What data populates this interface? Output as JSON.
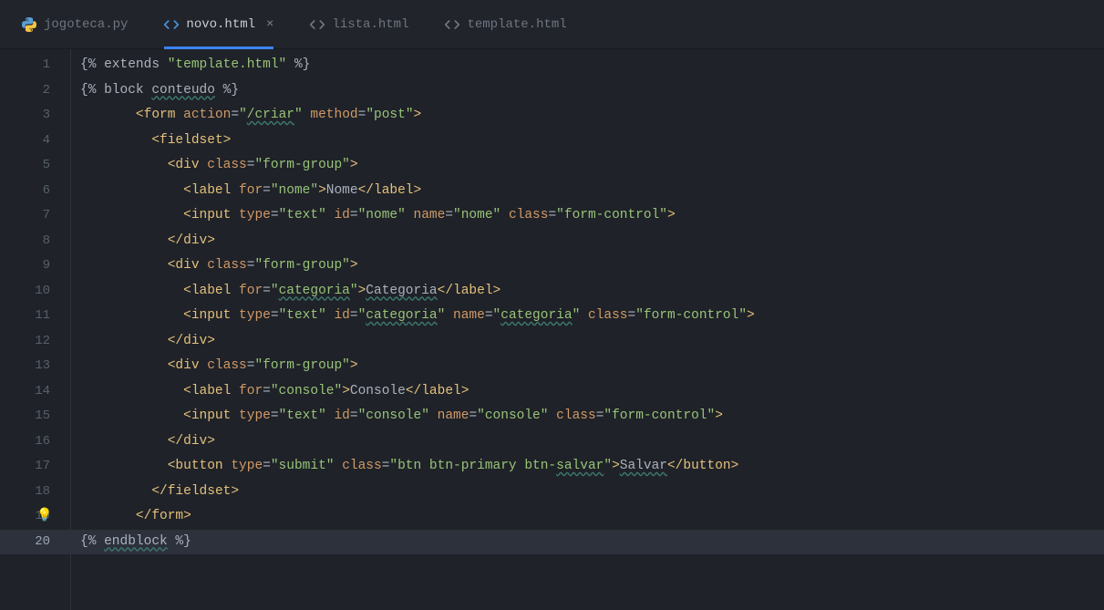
{
  "tabs": [
    {
      "label": "jogoteca.py",
      "type": "python",
      "active": false,
      "close": false
    },
    {
      "label": "novo.html",
      "type": "html",
      "active": true,
      "close": true
    },
    {
      "label": "lista.html",
      "type": "html",
      "active": false,
      "close": false
    },
    {
      "label": "template.html",
      "type": "html",
      "active": false,
      "close": false
    }
  ],
  "lines": {
    "1": {
      "n": "1"
    },
    "2": {
      "n": "2"
    },
    "3": {
      "n": "3"
    },
    "4": {
      "n": "4"
    },
    "5": {
      "n": "5"
    },
    "6": {
      "n": "6"
    },
    "7": {
      "n": "7"
    },
    "8": {
      "n": "8"
    },
    "9": {
      "n": "9"
    },
    "10": {
      "n": "10"
    },
    "11": {
      "n": "11"
    },
    "12": {
      "n": "12"
    },
    "13": {
      "n": "13"
    },
    "14": {
      "n": "14"
    },
    "15": {
      "n": "15"
    },
    "16": {
      "n": "16"
    },
    "17": {
      "n": "17"
    },
    "18": {
      "n": "18"
    },
    "19": {
      "n": "19"
    },
    "20": {
      "n": "20"
    }
  },
  "code": {
    "l1": {
      "extends": "{% extends ",
      "tpl": "\"template.html\"",
      "end": " %}"
    },
    "l2": {
      "block": "{% block ",
      "name": "conteudo",
      "end": " %}"
    },
    "l3": {
      "open": "<",
      "tag": "form",
      "sp": " ",
      "a1": "action",
      "eq": "=",
      "v1": "\"",
      "v1w": "/criar",
      "v1e": "\"",
      "sp2": " ",
      "a2": "method",
      "v2": "\"post\"",
      "close": ">"
    },
    "l4": {
      "open": "<",
      "tag": "fieldset",
      "close": ">"
    },
    "l5": {
      "open": "<",
      "tag": "div",
      "sp": " ",
      "a1": "class",
      "eq": "=",
      "v1": "\"form-group\"",
      "close": ">"
    },
    "l6": {
      "open": "<",
      "tag": "label",
      "sp": " ",
      "a1": "for",
      "eq": "=",
      "v1": "\"nome\"",
      "close": ">",
      "text": "Nome",
      "copen": "</",
      "ctag": "label",
      "cclose": ">"
    },
    "l7": {
      "open": "<",
      "tag": "input",
      "sp": " ",
      "a1": "type",
      "v1": "\"text\"",
      "a2": "id",
      "v2": "\"nome\"",
      "a3": "name",
      "v3": "\"nome\"",
      "a4": "class",
      "v4": "\"form-control\"",
      "close": ">"
    },
    "l8": {
      "open": "</",
      "tag": "div",
      "close": ">"
    },
    "l9": {
      "open": "<",
      "tag": "div",
      "sp": " ",
      "a1": "class",
      "eq": "=",
      "v1": "\"form-group\"",
      "close": ">"
    },
    "l10": {
      "open": "<",
      "tag": "label",
      "sp": " ",
      "a1": "for",
      "eq": "=",
      "v1q": "\"",
      "v1w": "categoria",
      "v1e": "\"",
      "close": ">",
      "text": "Categoria",
      "copen": "</",
      "ctag": "label",
      "cclose": ">"
    },
    "l11": {
      "open": "<",
      "tag": "input",
      "sp": " ",
      "a1": "type",
      "v1": "\"text\"",
      "a2": "id",
      "v2q": "\"",
      "v2w": "categoria",
      "v2e": "\"",
      "a3": "name",
      "v3q": "\"",
      "v3w": "categoria",
      "v3e": "\"",
      "a4": "class",
      "v4": "\"form-control\"",
      "close": ">"
    },
    "l12": {
      "open": "</",
      "tag": "div",
      "close": ">"
    },
    "l13": {
      "open": "<",
      "tag": "div",
      "sp": " ",
      "a1": "class",
      "eq": "=",
      "v1": "\"form-group\"",
      "close": ">"
    },
    "l14": {
      "open": "<",
      "tag": "label",
      "sp": " ",
      "a1": "for",
      "eq": "=",
      "v1": "\"console\"",
      "close": ">",
      "text": "Console",
      "copen": "</",
      "ctag": "label",
      "cclose": ">"
    },
    "l15": {
      "open": "<",
      "tag": "input",
      "sp": " ",
      "a1": "type",
      "v1": "\"text\"",
      "a2": "id",
      "v2": "\"console\"",
      "a3": "name",
      "v3": "\"console\"",
      "a4": "class",
      "v4": "\"form-control\"",
      "close": ">"
    },
    "l16": {
      "open": "</",
      "tag": "div",
      "close": ">"
    },
    "l17": {
      "open": "<",
      "tag": "button",
      "sp": " ",
      "a1": "type",
      "v1": "\"submit\"",
      "a2": "class",
      "v2a": "\"btn btn-primary btn-",
      "v2w": "salvar",
      "v2e": "\"",
      "close": ">",
      "text": "Salvar",
      "copen": "</",
      "ctag": "button",
      "cclose": ">"
    },
    "l18": {
      "open": "</",
      "tag": "fieldset",
      "close": ">"
    },
    "l19": {
      "open": "</",
      "tag": "form",
      "close": ">"
    },
    "l20": {
      "open": "{% ",
      "kw": "endblock",
      "end": " %}"
    }
  },
  "icons": {
    "bulb": "💡"
  }
}
